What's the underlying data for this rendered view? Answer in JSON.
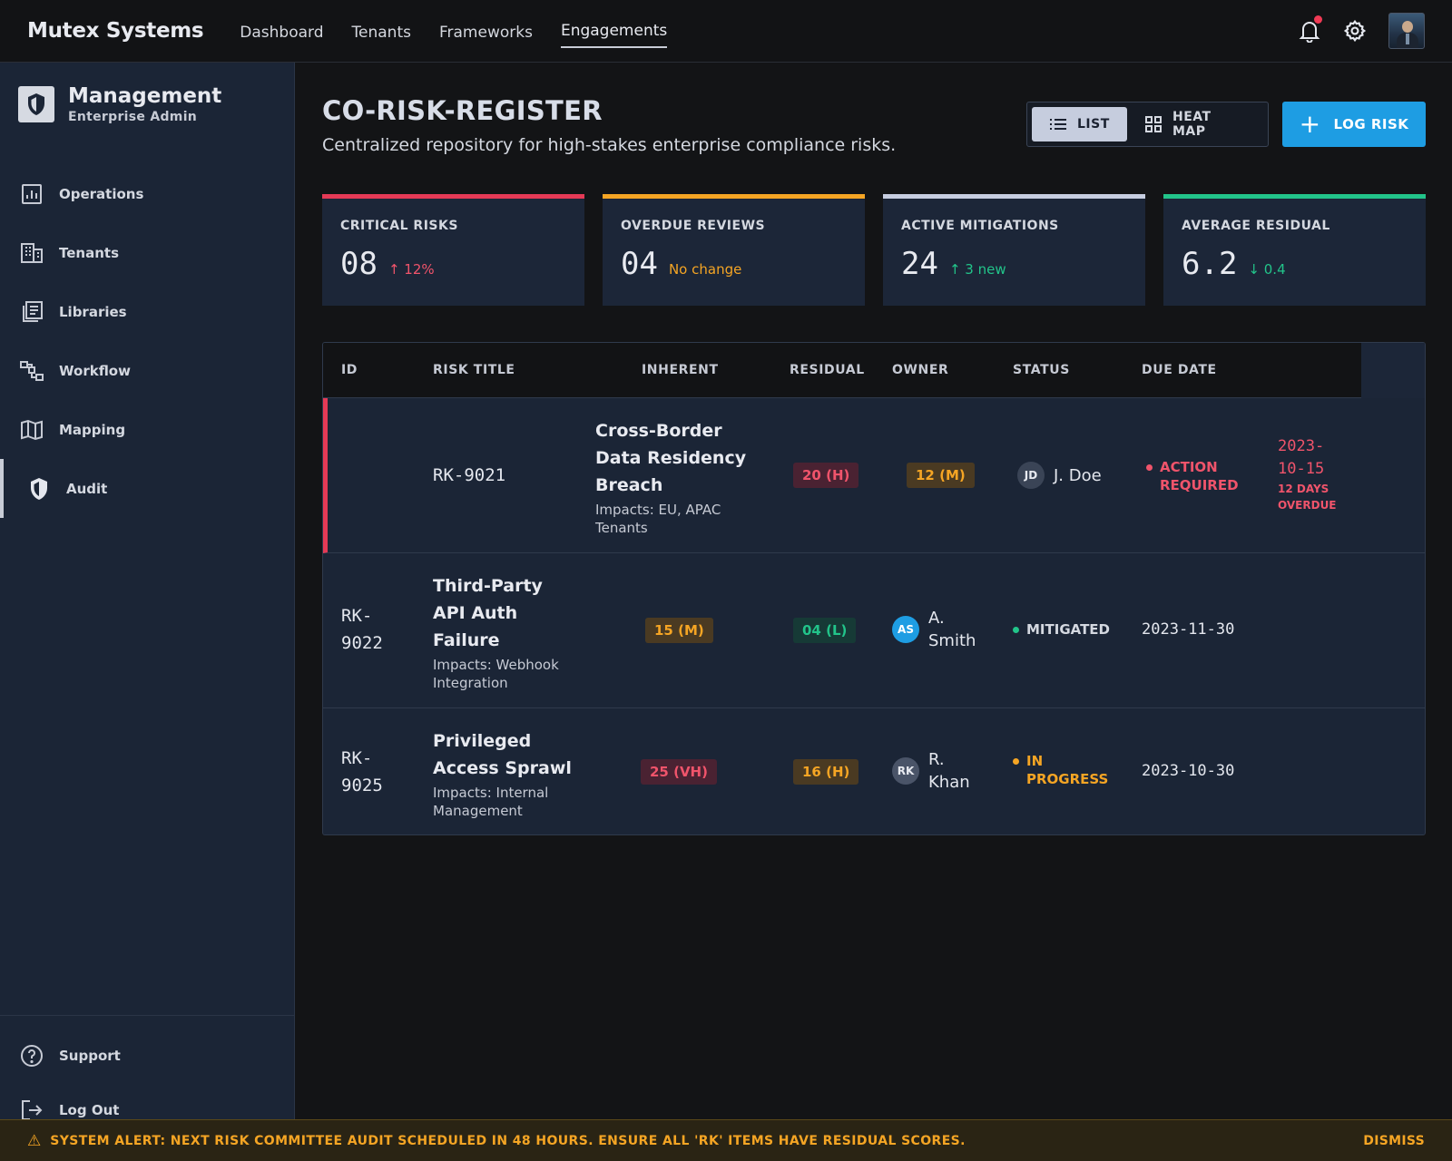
{
  "brand": "Mutex Systems",
  "top_nav": [
    {
      "label": "Dashboard",
      "active": false
    },
    {
      "label": "Tenants",
      "active": false
    },
    {
      "label": "Frameworks",
      "active": false
    },
    {
      "label": "Engagements",
      "active": true
    }
  ],
  "sidebar": {
    "title": "Management",
    "subtitle": "Enterprise Admin",
    "items": [
      {
        "label": "Operations",
        "icon": "chart-icon"
      },
      {
        "label": "Tenants",
        "icon": "building-icon"
      },
      {
        "label": "Libraries",
        "icon": "library-icon"
      },
      {
        "label": "Workflow",
        "icon": "workflow-icon"
      },
      {
        "label": "Mapping",
        "icon": "map-icon"
      },
      {
        "label": "Audit",
        "icon": "shield-icon",
        "active": true
      }
    ],
    "bottom": [
      {
        "label": "Support",
        "icon": "help-icon"
      },
      {
        "label": "Log Out",
        "icon": "logout-icon"
      }
    ]
  },
  "page": {
    "title": "CO-RISK-REGISTER",
    "subtitle": "Centralized repository for high-stakes enterprise compliance risks.",
    "view_list": "LIST",
    "view_heatmap": "HEAT MAP",
    "log_risk": "LOG RISK"
  },
  "stats": [
    {
      "label": "CRITICAL RISKS",
      "value": "08",
      "delta": "↑ 12%",
      "accent": "#e53a56",
      "delta_color": "#f0546b"
    },
    {
      "label": "OVERDUE REVIEWS",
      "value": "04",
      "delta": "No change",
      "accent": "#f5a524",
      "delta_color": "#f5a524"
    },
    {
      "label": "ACTIVE MITIGATIONS",
      "value": "24",
      "delta": "↑ 3 new",
      "accent": "#c6cde0",
      "delta_color": "#22c48a"
    },
    {
      "label": "AVERAGE RESIDUAL",
      "value": "6.2",
      "delta": "↓ 0.4",
      "accent": "#22c48a",
      "delta_color": "#22c48a"
    }
  ],
  "table": {
    "headers": {
      "id": "ID",
      "title": "RISK TITLE",
      "inherent": "INHERENT",
      "residual": "RESIDUAL",
      "owner": "OWNER",
      "status": "STATUS",
      "due": "DUE DATE"
    },
    "rows": [
      {
        "id": "RK-9021",
        "title_lines": [
          "Cross-Border",
          "Data Residency",
          "Breach"
        ],
        "impact_lines": [
          "Impacts: EU, APAC",
          "Tenants"
        ],
        "inherent": "20 (H)",
        "residual": "12 (M)",
        "owner_initials": "JD",
        "owner_name_lines": [
          "J. Doe"
        ],
        "status_lines": [
          "ACTION",
          "REQUIRED"
        ],
        "due_lines": [
          "2023-",
          "10-15"
        ],
        "due_sub_lines": [
          "12 DAYS",
          "OVERDUE"
        ]
      },
      {
        "id_lines": [
          "RK-",
          "9022"
        ],
        "title_lines": [
          "Third-Party",
          "API Auth",
          "Failure"
        ],
        "impact_lines": [
          "Impacts: Webhook",
          "Integration"
        ],
        "inherent": "15 (M)",
        "residual": "04 (L)",
        "owner_initials": "AS",
        "owner_name_lines": [
          "A.",
          "Smith"
        ],
        "status_lines": [
          "MITIGATED"
        ],
        "due": "2023-11-30"
      },
      {
        "id_lines": [
          "RK-",
          "9025"
        ],
        "title_lines": [
          "Privileged",
          "Access Sprawl"
        ],
        "impact_lines": [
          "Impacts: Internal",
          "Management"
        ],
        "inherent": "25 (VH)",
        "residual": "16 (H)",
        "owner_initials": "RK",
        "owner_name_lines": [
          "R.",
          "Khan"
        ],
        "status_lines": [
          "IN",
          "PROGRESS"
        ],
        "due": "2023-10-30"
      }
    ]
  },
  "alert": {
    "text": "SYSTEM ALERT: NEXT RISK COMMITTEE AUDIT SCHEDULED IN 48 HOURS. ENSURE ALL 'RK' ITEMS HAVE RESIDUAL SCORES.",
    "dismiss": "DISMISS"
  }
}
